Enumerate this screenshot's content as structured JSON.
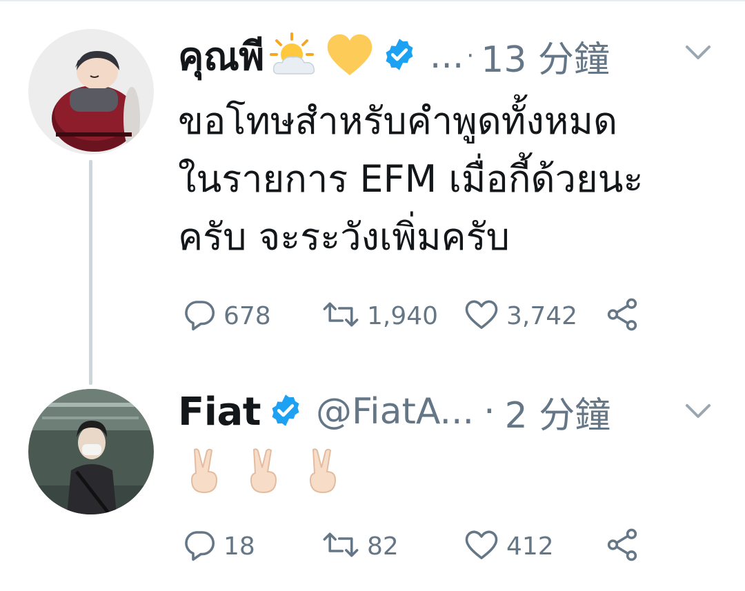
{
  "tweets": [
    {
      "name": "คุณพี",
      "handle": "...",
      "time": "13 分鐘",
      "separator": "·",
      "text_lines": [
        "ขอโทษสำหรับคำพูดทั้งหมด",
        "ในรายการ EFM เมื่อกี้ด้วยนะ",
        "ครับ จะระวังเพิ่มครับ"
      ],
      "replies": "678",
      "retweets": "1,940",
      "likes": "3,742"
    },
    {
      "name": "Fiat",
      "handle": "@FiatA...",
      "time": "2 分鐘",
      "separator": "·",
      "replies": "18",
      "retweets": "82",
      "likes": "412"
    }
  ],
  "colors": {
    "verified": "#1da1f2",
    "text": "#14171a",
    "secondary": "#657786",
    "thread_line": "#ccd6dd"
  },
  "icons": [
    "sun-behind-cloud-icon",
    "yellow-heart-icon",
    "verified-badge-icon",
    "chevron-down-icon",
    "reply-icon",
    "retweet-icon",
    "like-icon",
    "share-icon",
    "victory-hand-icon"
  ]
}
